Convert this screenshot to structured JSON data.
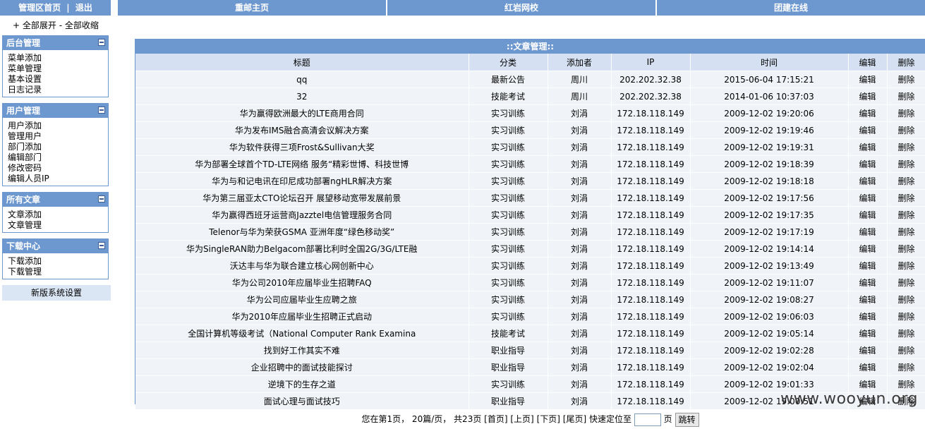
{
  "topbar": {
    "admin_home": "管理区首页",
    "separator": "|",
    "logout": "退出",
    "nav": [
      "重邮主页",
      "红岩网校",
      "团建在线"
    ]
  },
  "sidebar": {
    "expand_all": "+ 全部展开",
    "dash": " - ",
    "collapse_all": "全部收缩",
    "panels": [
      {
        "title": "后台管理",
        "items": [
          "菜单添加",
          "菜单管理",
          "基本设置",
          "日志记录"
        ]
      },
      {
        "title": "用户管理",
        "items": [
          "用户添加",
          "管理用户",
          "部门添加",
          "编辑部门",
          "修改密码",
          "编辑人员IP"
        ]
      },
      {
        "title": "所有文章",
        "items": [
          "文章添加",
          "文章管理"
        ]
      },
      {
        "title": "下载中心",
        "items": [
          "下载添加",
          "下载管理"
        ]
      }
    ],
    "new_settings": "新版系统设置"
  },
  "main": {
    "title": "::文章管理::",
    "columns": [
      "标题",
      "分类",
      "添加者",
      "IP",
      "时间",
      "编辑",
      "删除"
    ],
    "rows": [
      [
        "qq",
        "最新公告",
        "周川",
        "202.202.32.38",
        "2015-06-04 17:15:21",
        "编辑",
        "删除"
      ],
      [
        "32",
        "技能考试",
        "周川",
        "202.202.32.38",
        "2014-01-06 10:37:03",
        "编辑",
        "删除"
      ],
      [
        "华为赢得欧洲最大的LTE商用合同",
        "实习训练",
        "刘涓",
        "172.18.118.149",
        "2009-12-02 19:20:06",
        "编辑",
        "删除"
      ],
      [
        "华为发布IMS融合高清会议解决方案",
        "实习训练",
        "刘涓",
        "172.18.118.149",
        "2009-12-02 19:19:46",
        "编辑",
        "删除"
      ],
      [
        "华为软件获得三项Frost&Sullivan大奖",
        "实习训练",
        "刘涓",
        "172.18.118.149",
        "2009-12-02 19:19:31",
        "编辑",
        "删除"
      ],
      [
        "华为部署全球首个TD-LTE网络 服务“精彩世博、科技世博",
        "实习训练",
        "刘涓",
        "172.18.118.149",
        "2009-12-02 19:18:39",
        "编辑",
        "删除"
      ],
      [
        "华为与和记电讯在印尼成功部署ngHLR解决方案",
        "实习训练",
        "刘涓",
        "172.18.118.149",
        "2009-12-02 19:18:18",
        "编辑",
        "删除"
      ],
      [
        "华为第三届亚太CTO论坛召开 展望移动宽带发展前景",
        "实习训练",
        "刘涓",
        "172.18.118.149",
        "2009-12-02 19:17:56",
        "编辑",
        "删除"
      ],
      [
        "华为赢得西班牙运营商Jazztel电信管理服务合同",
        "实习训练",
        "刘涓",
        "172.18.118.149",
        "2009-12-02 19:17:35",
        "编辑",
        "删除"
      ],
      [
        "Telenor与华为荣获GSMA 亚洲年度“绿色移动奖”",
        "实习训练",
        "刘涓",
        "172.18.118.149",
        "2009-12-02 19:17:19",
        "编辑",
        "删除"
      ],
      [
        "华为SingleRAN助力Belgacom部署比利时全国2G/3G/LTE融",
        "实习训练",
        "刘涓",
        "172.18.118.149",
        "2009-12-02 19:14:14",
        "编辑",
        "删除"
      ],
      [
        "沃达丰与华为联合建立核心网创新中心",
        "实习训练",
        "刘涓",
        "172.18.118.149",
        "2009-12-02 19:13:49",
        "编辑",
        "删除"
      ],
      [
        "华为公司2010年应届毕业生招聘FAQ",
        "实习训练",
        "刘涓",
        "172.18.118.149",
        "2009-12-02 19:11:07",
        "编辑",
        "删除"
      ],
      [
        "华为公司应届毕业生应聘之旅",
        "实习训练",
        "刘涓",
        "172.18.118.149",
        "2009-12-02 19:08:27",
        "编辑",
        "删除"
      ],
      [
        "华为2010年应届毕业生招聘正式启动",
        "实习训练",
        "刘涓",
        "172.18.118.149",
        "2009-12-02 19:06:03",
        "编辑",
        "删除"
      ],
      [
        "全国计算机等级考试（National Computer Rank Examina",
        "技能考试",
        "刘涓",
        "172.18.118.149",
        "2009-12-02 19:05:14",
        "编辑",
        "删除"
      ],
      [
        "找到好工作其实不难",
        "职业指导",
        "刘涓",
        "172.18.118.149",
        "2009-12-02 19:02:28",
        "编辑",
        "删除"
      ],
      [
        "企业招聘中的面试技能探讨",
        "职业指导",
        "刘涓",
        "172.18.118.149",
        "2009-12-02 19:02:04",
        "编辑",
        "删除"
      ],
      [
        "逆境下的生存之道",
        "实习训练",
        "刘涓",
        "172.18.118.149",
        "2009-12-02 19:01:33",
        "编辑",
        "删除"
      ],
      [
        "面试心理与面试技巧",
        "职业指导",
        "刘涓",
        "172.18.118.149",
        "2009-12-02 19:00:51",
        "编辑",
        "删除"
      ]
    ]
  },
  "pager": {
    "info": "您在第1页， 20篇/页， 共23页",
    "first": "[首页]",
    "prev": "[上页]",
    "next": "[下页]",
    "last": "[尾页]",
    "jump_label": "快速定位至",
    "page_unit": "页",
    "jump_button": "跳转"
  },
  "watermark": "www.wooyun.org"
}
